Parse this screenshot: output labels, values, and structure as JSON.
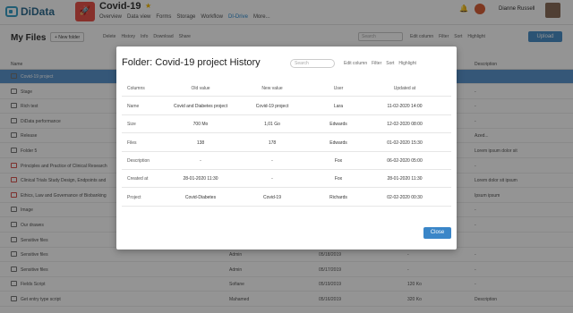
{
  "app": {
    "logo": "DiData",
    "project_title": "Covid-19"
  },
  "nav": [
    "Overview",
    "Data view",
    "Forms",
    "Storage",
    "Workflow",
    "DI-Drive",
    "More..."
  ],
  "user": {
    "name": "Dianne Russell"
  },
  "toolbar": {
    "page_title": "My Files",
    "new_folder": "+ New folder",
    "actions": [
      "Delete",
      "History",
      "Info",
      "Download",
      "Share"
    ],
    "search_placeholder": "Search",
    "right_actions": [
      "Edit column",
      "Filter",
      "Sort",
      "Highlight"
    ],
    "upload": "Upload"
  },
  "file_table": {
    "headers": {
      "name": "Name",
      "description": "Description"
    },
    "rows": [
      {
        "name": "Covid-19 project",
        "owner": "",
        "date": "",
        "size": "",
        "desc": "",
        "selected": true,
        "pdf": false
      },
      {
        "name": "Stage",
        "owner": "",
        "date": "",
        "size": "",
        "desc": "-",
        "selected": false,
        "pdf": false
      },
      {
        "name": "Rich test",
        "owner": "",
        "date": "",
        "size": "",
        "desc": "-",
        "selected": false,
        "pdf": false
      },
      {
        "name": "DiData performance",
        "owner": "",
        "date": "",
        "size": "",
        "desc": "-",
        "selected": false,
        "pdf": false
      },
      {
        "name": "Release",
        "owner": "",
        "date": "",
        "size": "",
        "desc": "Azed...",
        "selected": false,
        "pdf": false
      },
      {
        "name": "Folder 5",
        "owner": "",
        "date": "",
        "size": "",
        "desc": "Lorem ipsum dolor sit",
        "selected": false,
        "pdf": false
      },
      {
        "name": "Principles and Practice of Clinical Research",
        "owner": "",
        "date": "",
        "size": "",
        "desc": "-",
        "selected": false,
        "pdf": true
      },
      {
        "name": "Clinical Trials Study Design, Endpoints and",
        "owner": "",
        "date": "",
        "size": "",
        "desc": "Lorem dolor sit ipsum",
        "selected": false,
        "pdf": true
      },
      {
        "name": "Ethics, Law and Governance of Biobanking",
        "owner": "",
        "date": "",
        "size": "",
        "desc": "Ipsum ipsum",
        "selected": false,
        "pdf": true
      },
      {
        "name": "Image",
        "owner": "",
        "date": "",
        "size": "",
        "desc": "-",
        "selected": false,
        "pdf": false
      },
      {
        "name": "Our drawes",
        "owner": "",
        "date": "",
        "size": "",
        "desc": "-",
        "selected": false,
        "pdf": false
      },
      {
        "name": "Sensitive files",
        "owner": "",
        "date": "",
        "size": "",
        "desc": "",
        "selected": false,
        "pdf": false
      },
      {
        "name": "Sensitive files",
        "owner": "Admin",
        "date": "05/18/2019",
        "size": "-",
        "desc": "-",
        "selected": false,
        "pdf": false
      },
      {
        "name": "Sensitive files",
        "owner": "Admin",
        "date": "05/17/2019",
        "size": "-",
        "desc": "-",
        "selected": false,
        "pdf": false
      },
      {
        "name": "Fields Script",
        "owner": "Sofiane",
        "date": "05/19/2019",
        "size": "120 Ko",
        "desc": "-",
        "selected": false,
        "pdf": false
      },
      {
        "name": "Get entry type script",
        "owner": "Mahamed",
        "date": "05/16/2019",
        "size": "320 Ko",
        "desc": "Description",
        "selected": false,
        "pdf": false
      }
    ]
  },
  "modal": {
    "title": "Folder: Covid-19 project History",
    "search_placeholder": "Search",
    "tools": [
      "Edit column",
      "Filter",
      "Sort",
      "Highlight"
    ],
    "headers": [
      "Columns",
      "Old value",
      "New value",
      "User",
      "Updated at"
    ],
    "rows": [
      [
        "Name",
        "Covid and Diabetes project",
        "Covid-19 project",
        "Lara",
        "11-02-2020 14:00"
      ],
      [
        "Size",
        "700 Mo",
        "1,01 Go",
        "Edwards",
        "12-02-2020 08:00"
      ],
      [
        "Files",
        "138",
        "178",
        "Edwards",
        "01-02-2020 15:30"
      ],
      [
        "Description",
        "-",
        "-",
        "Fox",
        "06-02-2020 05:00"
      ],
      [
        "Created at",
        "28-01-2020 11:30",
        "-",
        "Fox",
        "28-01-2020 11:30"
      ],
      [
        "Project",
        "Covid-Diabetes",
        "Covid-19",
        "Richards",
        "02-02-2020 00:30"
      ]
    ],
    "close": "Close"
  }
}
